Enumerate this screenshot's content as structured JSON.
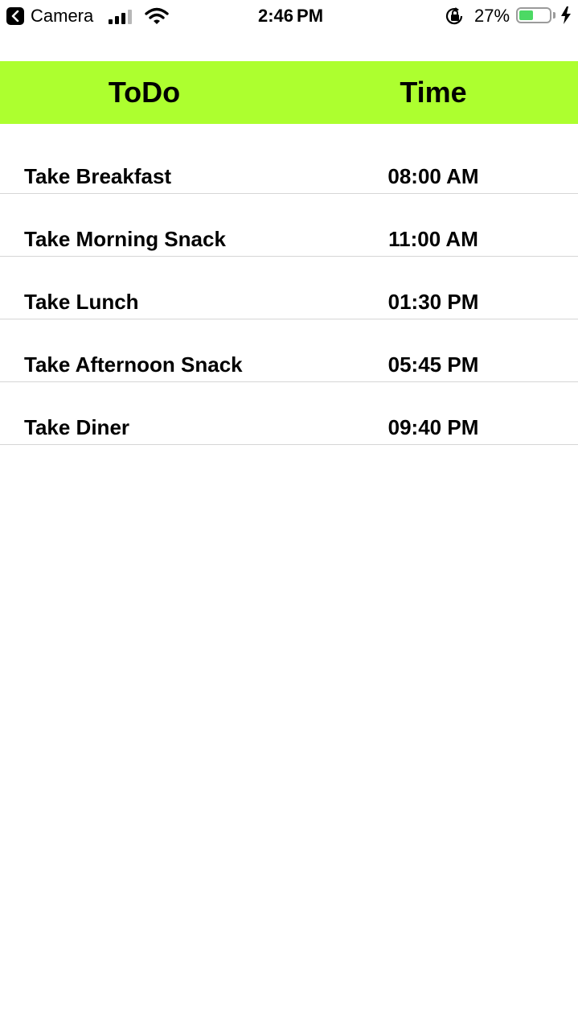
{
  "status_bar": {
    "back_app": "Camera",
    "time": "2:46",
    "time_suffix": "PM",
    "battery_percent": "27%",
    "battery_level": 0.27,
    "icons": [
      "back-chevron-icon",
      "signal-icon",
      "wifi-icon",
      "orientation-lock-icon",
      "battery-icon",
      "charging-bolt-icon"
    ]
  },
  "header": {
    "todo_label": "ToDo",
    "time_label": "Time",
    "color": "#adff2f"
  },
  "todos": [
    {
      "task": "Take Breakfast",
      "time": "08:00 AM"
    },
    {
      "task": "Take Morning Snack",
      "time": "11:00 AM"
    },
    {
      "task": "Take Lunch",
      "time": "01:30 PM"
    },
    {
      "task": "Take Afternoon Snack",
      "time": "05:45 PM"
    },
    {
      "task": "Take Diner",
      "time": "09:40 PM"
    }
  ]
}
